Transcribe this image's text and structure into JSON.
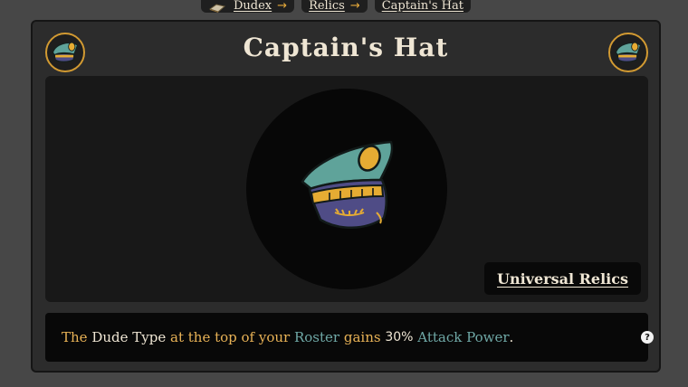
{
  "breadcrumb": {
    "items": [
      {
        "label": "Dudex",
        "icon": "book-icon",
        "arrow": "→"
      },
      {
        "label": "Relics",
        "arrow": "→"
      },
      {
        "label": "Captain's Hat"
      }
    ]
  },
  "relic": {
    "title": "Captain's Hat",
    "icon": "captain-hat-icon",
    "category": "Universal Relics",
    "description": {
      "p1": "The",
      "p2": "Dude Type",
      "p3": "at the top of your",
      "p4": "Roster",
      "p5": "gains",
      "p6": "30%",
      "p7": "Attack Power",
      "p8": "."
    },
    "help": "?"
  },
  "colors": {
    "accent_gold": "#e8b256",
    "keyword_teal": "#6fa8a6",
    "text_cream": "#efe6d4",
    "ring_gold": "#d29a32"
  }
}
